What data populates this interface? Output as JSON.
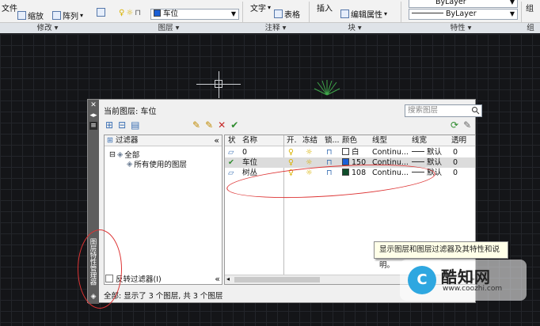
{
  "ribbon": {
    "row1": {
      "file_label": "文件",
      "zoom_label": "缩放",
      "array_label": "阵列",
      "layer_combo_value": "车位",
      "text_label": "文字",
      "table_label": "表格",
      "insert_label": "插入",
      "edit_attr_label": "编辑属性",
      "bylayer_top": "ByLayer",
      "bylayer_line": "ByLayer",
      "group_label": "组"
    },
    "panels": {
      "modify": "修改 ▾",
      "layers": "图层 ▾",
      "annotation": "注释 ▾",
      "block": "块 ▾",
      "properties": "特性 ▾",
      "group": "组"
    }
  },
  "palette": {
    "strip_title": "图层特性管理器",
    "current_layer": "当前图层: 车位",
    "search_placeholder": "搜索图层",
    "filter_header": "过滤器",
    "tree": {
      "all": "全部",
      "all_used": "所有使用的图层"
    },
    "invert_filter": "反转过滤器(I)",
    "columns": [
      "状",
      "名称",
      "开.",
      "冻结",
      "锁...",
      "颜色",
      "线型",
      "线宽",
      "透明"
    ],
    "layers": [
      {
        "status": "",
        "name": "0",
        "color_name": "白",
        "color_hex": "#ffffff",
        "linetype": "Continu...",
        "lineweight": "默认",
        "transparency": "0"
      },
      {
        "status": "✔",
        "name": "车位",
        "color_name": "150",
        "color_hex": "#1a5fd6",
        "linetype": "Continu...",
        "lineweight": "默认",
        "transparency": "0"
      },
      {
        "status": "",
        "name": "树丛",
        "color_name": "108",
        "color_hex": "#0f4d2a",
        "linetype": "Continu...",
        "lineweight": "默认",
        "transparency": "0"
      }
    ],
    "status_text": "全部: 显示了 3 个图层, 共 3 个图层"
  },
  "tooltip": "显示图层和图层过滤器及其特性和说明。",
  "watermark": {
    "name": "酷知网",
    "url": "www.coozhi.com"
  },
  "colors": {
    "annotation_red": "#dd3333",
    "palette_bg": "#f0f0f0"
  }
}
